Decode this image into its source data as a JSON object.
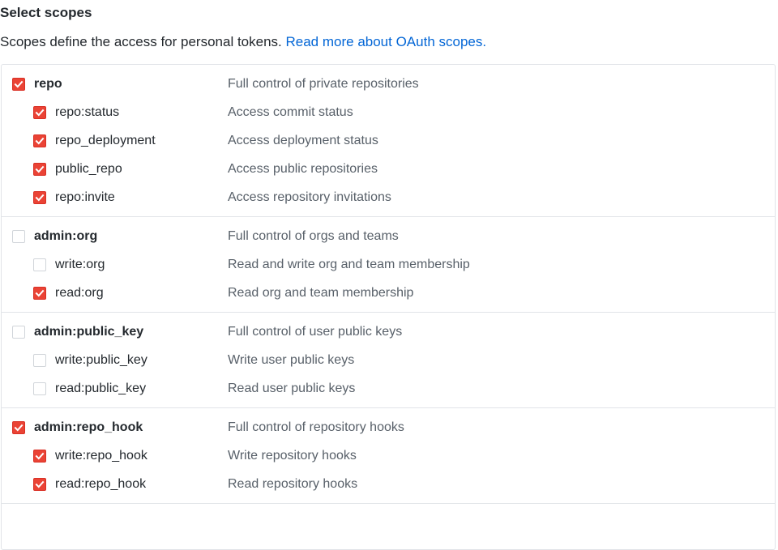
{
  "header": {
    "title": "Select scopes",
    "description": "Scopes define the access for personal tokens.",
    "link_label": "Read more about OAuth scopes."
  },
  "colors": {
    "checkbox_checked": "#ea4335",
    "link": "#0366d6",
    "description_text": "#586069",
    "border": "#e1e4e8"
  },
  "groups": [
    {
      "parent": {
        "name": "repo",
        "description": "Full control of private repositories",
        "checked": true
      },
      "children": [
        {
          "name": "repo:status",
          "description": "Access commit status",
          "checked": true
        },
        {
          "name": "repo_deployment",
          "description": "Access deployment status",
          "checked": true
        },
        {
          "name": "public_repo",
          "description": "Access public repositories",
          "checked": true
        },
        {
          "name": "repo:invite",
          "description": "Access repository invitations",
          "checked": true
        }
      ]
    },
    {
      "parent": {
        "name": "admin:org",
        "description": "Full control of orgs and teams",
        "checked": false
      },
      "children": [
        {
          "name": "write:org",
          "description": "Read and write org and team membership",
          "checked": false
        },
        {
          "name": "read:org",
          "description": "Read org and team membership",
          "checked": true
        }
      ]
    },
    {
      "parent": {
        "name": "admin:public_key",
        "description": "Full control of user public keys",
        "checked": false
      },
      "children": [
        {
          "name": "write:public_key",
          "description": "Write user public keys",
          "checked": false
        },
        {
          "name": "read:public_key",
          "description": "Read user public keys",
          "checked": false
        }
      ]
    },
    {
      "parent": {
        "name": "admin:repo_hook",
        "description": "Full control of repository hooks",
        "checked": true
      },
      "children": [
        {
          "name": "write:repo_hook",
          "description": "Write repository hooks",
          "checked": true
        },
        {
          "name": "read:repo_hook",
          "description": "Read repository hooks",
          "checked": true
        }
      ]
    }
  ]
}
